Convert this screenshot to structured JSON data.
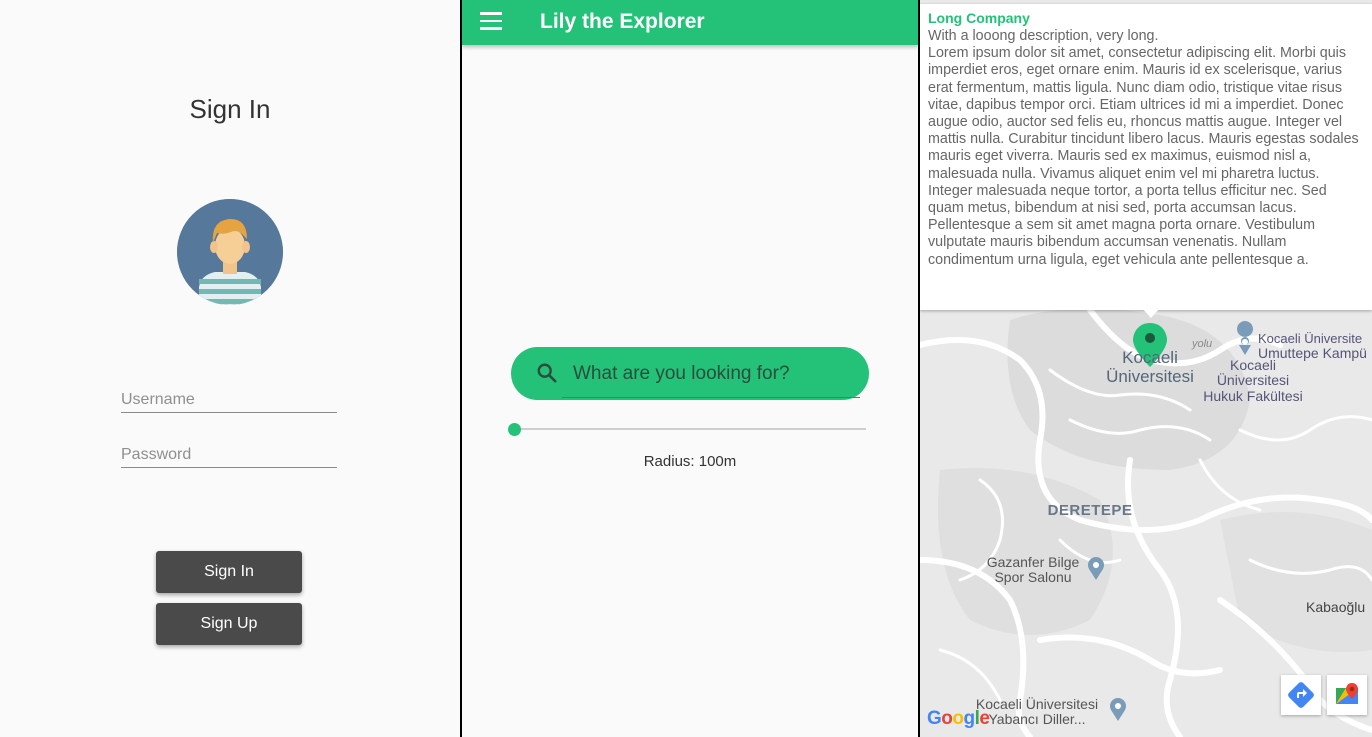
{
  "signin": {
    "title": "Sign In",
    "username_placeholder": "Username",
    "password_placeholder": "Password",
    "signin_button": "Sign In",
    "signup_button": "Sign Up"
  },
  "search": {
    "app_title": "Lily the Explorer",
    "search_placeholder": "What are you looking for?",
    "radius_label": "Radius: 100m",
    "radius_value_fraction": 0.0
  },
  "map": {
    "info_title": "Long Company",
    "info_description": "With a looong description, very long.\nLorem ipsum dolor sit amet, consectetur adipiscing elit. Morbi quis imperdiet eros, eget ornare enim. Mauris id ex scelerisque, varius erat fermentum, mattis ligula. Nunc diam odio, tristique vitae risus vitae, dapibus tempor orci. Etiam ultrices id mi a imperdiet. Donec augue odio, auctor sed felis eu, rhoncus mattis augue. Integer vel mattis nulla. Curabitur tincidunt libero lacus. Mauris egestas sodales mauris eget viverra. Mauris sed ex maximus, euismod nisl a, malesuada nulla. Vivamus aliquet enim vel mi pharetra luctus. Integer malesuada neque tortor, a porta tellus efficitur nec. Sed quam metus, bibendum at nisi sed, porta accumsan lacus. Pellentesque a sem sit amet magna porta ornare. Vestibulum vulputate mauris bibendum accumsan venenatis. Nullam condimentum urna ligula, eget vehicula ante pellentesque a.",
    "labels": {
      "kocaeli_univ": "Kocaeli Üniversitesi",
      "hukuk": "Kocaeli Üniversitesi Hukuk Fakültesi",
      "umuttepe_top": "Kocaeli Üniversite",
      "umuttepe": "Umuttepe Kampü",
      "deretepe": "DERETEPE",
      "gazanfer": "Gazanfer Bilge Spor Salonu",
      "kabaoglu": "Kabaoğlu",
      "yabanci": "Kocaeli Üniversitesi Yabancı Diller...",
      "road_fragment": "yolu"
    },
    "google": "Google",
    "colors": {
      "accent": "#24c178",
      "pin": "#24c178",
      "poi": "#7a9cb8"
    }
  }
}
